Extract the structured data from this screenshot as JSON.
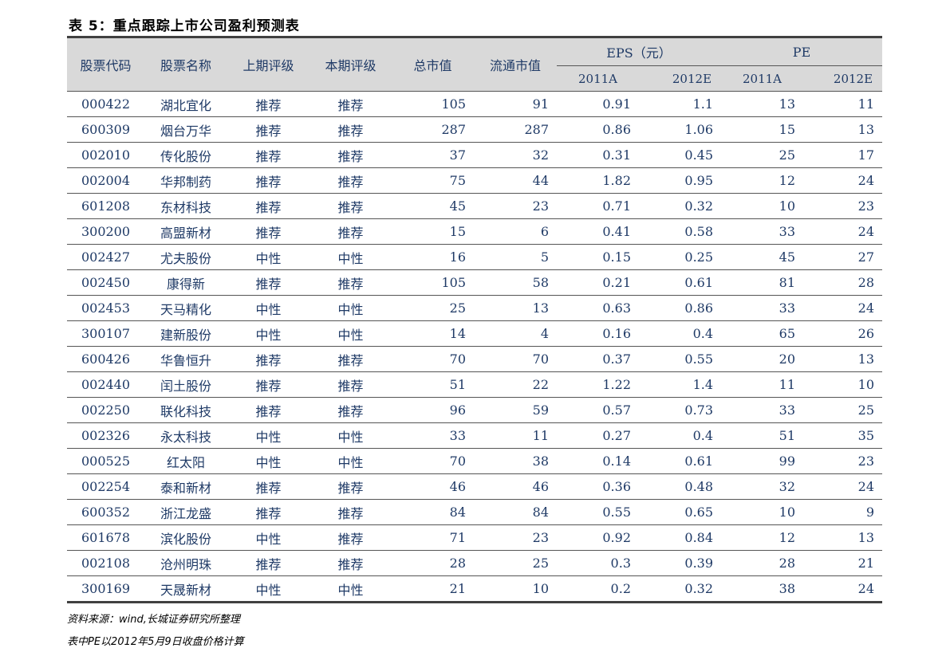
{
  "title": "表 5：重点跟踪上市公司盈利预测表",
  "headers": {
    "code": "股票代码",
    "name": "股票名称",
    "prev_rating": "上期评级",
    "cur_rating": "本期评级",
    "total_mv": "总市值",
    "float_mv": "流通市值",
    "eps": "EPS（元）",
    "pe": "PE",
    "y2011": "2011A",
    "y2012": "2012E"
  },
  "rows": [
    {
      "code": "000422",
      "name": "湖北宜化",
      "prev": "推荐",
      "cur": "推荐",
      "total": "105",
      "float": "91",
      "eps2011": "0.91",
      "eps2012": "1.1",
      "pe2011": "13",
      "pe2012": "11"
    },
    {
      "code": "600309",
      "name": "烟台万华",
      "prev": "推荐",
      "cur": "推荐",
      "total": "287",
      "float": "287",
      "eps2011": "0.86",
      "eps2012": "1.06",
      "pe2011": "15",
      "pe2012": "13"
    },
    {
      "code": "002010",
      "name": "传化股份",
      "prev": "推荐",
      "cur": "推荐",
      "total": "37",
      "float": "32",
      "eps2011": "0.31",
      "eps2012": "0.45",
      "pe2011": "25",
      "pe2012": "17"
    },
    {
      "code": "002004",
      "name": "华邦制药",
      "prev": "推荐",
      "cur": "推荐",
      "total": "75",
      "float": "44",
      "eps2011": "1.82",
      "eps2012": "0.95",
      "pe2011": "12",
      "pe2012": "24"
    },
    {
      "code": "601208",
      "name": "东材科技",
      "prev": "推荐",
      "cur": "推荐",
      "total": "45",
      "float": "23",
      "eps2011": "0.71",
      "eps2012": "0.32",
      "pe2011": "10",
      "pe2012": "23"
    },
    {
      "code": "300200",
      "name": "高盟新材",
      "prev": "推荐",
      "cur": "推荐",
      "total": "15",
      "float": "6",
      "eps2011": "0.41",
      "eps2012": "0.58",
      "pe2011": "33",
      "pe2012": "24"
    },
    {
      "code": "002427",
      "name": "尤夫股份",
      "prev": "中性",
      "cur": "中性",
      "total": "16",
      "float": "5",
      "eps2011": "0.15",
      "eps2012": "0.25",
      "pe2011": "45",
      "pe2012": "27"
    },
    {
      "code": "002450",
      "name": "康得新",
      "prev": "推荐",
      "cur": "推荐",
      "total": "105",
      "float": "58",
      "eps2011": "0.21",
      "eps2012": "0.61",
      "pe2011": "81",
      "pe2012": "28"
    },
    {
      "code": "002453",
      "name": "天马精化",
      "prev": "中性",
      "cur": "中性",
      "total": "25",
      "float": "13",
      "eps2011": "0.63",
      "eps2012": "0.86",
      "pe2011": "33",
      "pe2012": "24"
    },
    {
      "code": "300107",
      "name": "建新股份",
      "prev": "中性",
      "cur": "中性",
      "total": "14",
      "float": "4",
      "eps2011": "0.16",
      "eps2012": "0.4",
      "pe2011": "65",
      "pe2012": "26"
    },
    {
      "code": "600426",
      "name": "华鲁恒升",
      "prev": "推荐",
      "cur": "推荐",
      "total": "70",
      "float": "70",
      "eps2011": "0.37",
      "eps2012": "0.55",
      "pe2011": "20",
      "pe2012": "13"
    },
    {
      "code": "002440",
      "name": "闰土股份",
      "prev": "推荐",
      "cur": "推荐",
      "total": "51",
      "float": "22",
      "eps2011": "1.22",
      "eps2012": "1.4",
      "pe2011": "11",
      "pe2012": "10"
    },
    {
      "code": "002250",
      "name": "联化科技",
      "prev": "推荐",
      "cur": "推荐",
      "total": "96",
      "float": "59",
      "eps2011": "0.57",
      "eps2012": "0.73",
      "pe2011": "33",
      "pe2012": "25"
    },
    {
      "code": "002326",
      "name": "永太科技",
      "prev": "中性",
      "cur": "中性",
      "total": "33",
      "float": "11",
      "eps2011": "0.27",
      "eps2012": "0.4",
      "pe2011": "51",
      "pe2012": "35"
    },
    {
      "code": "000525",
      "name": "红太阳",
      "prev": "中性",
      "cur": "中性",
      "total": "70",
      "float": "38",
      "eps2011": "0.14",
      "eps2012": "0.61",
      "pe2011": "99",
      "pe2012": "23"
    },
    {
      "code": "002254",
      "name": "泰和新材",
      "prev": "推荐",
      "cur": "推荐",
      "total": "46",
      "float": "46",
      "eps2011": "0.36",
      "eps2012": "0.48",
      "pe2011": "32",
      "pe2012": "24"
    },
    {
      "code": "600352",
      "name": "浙江龙盛",
      "prev": "推荐",
      "cur": "推荐",
      "total": "84",
      "float": "84",
      "eps2011": "0.55",
      "eps2012": "0.65",
      "pe2011": "10",
      "pe2012": "9"
    },
    {
      "code": "601678",
      "name": "滨化股份",
      "prev": "中性",
      "cur": "推荐",
      "total": "71",
      "float": "23",
      "eps2011": "0.92",
      "eps2012": "0.84",
      "pe2011": "12",
      "pe2012": "13"
    },
    {
      "code": "002108",
      "name": "沧州明珠",
      "prev": "推荐",
      "cur": "推荐",
      "total": "28",
      "float": "25",
      "eps2011": "0.3",
      "eps2012": "0.39",
      "pe2011": "28",
      "pe2012": "21"
    },
    {
      "code": "300169",
      "name": "天晟新材",
      "prev": "中性",
      "cur": "中性",
      "total": "21",
      "float": "10",
      "eps2011": "0.2",
      "eps2012": "0.32",
      "pe2011": "38",
      "pe2012": "24"
    }
  ],
  "source_note": "资料来源：wind,长城证券研究所整理",
  "footnote": "表中PE以2012年5月9日收盘价格计算"
}
